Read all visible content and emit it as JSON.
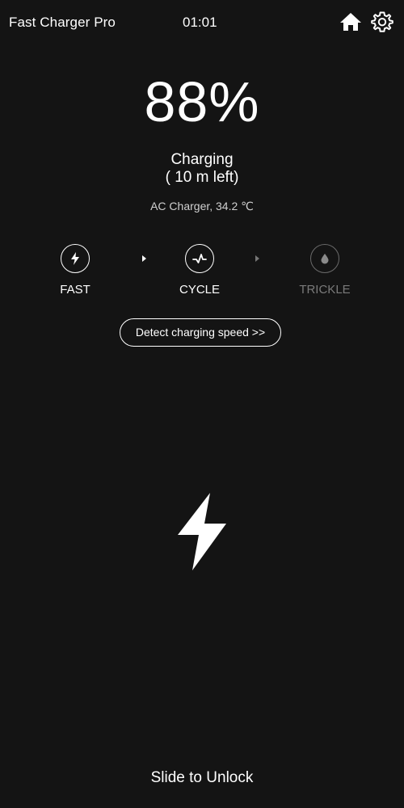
{
  "header": {
    "app_title": "Fast Charger Pro",
    "time": "01:01",
    "home_icon": "home-icon",
    "settings_icon": "gear-icon"
  },
  "battery": {
    "percent": "88%",
    "status": "Charging",
    "time_left": "( 10 m left)",
    "charger_info": "AC Charger, 34.2 ℃"
  },
  "modes": [
    {
      "label": "FAST",
      "icon": "bolt-icon",
      "active": true
    },
    {
      "label": "CYCLE",
      "icon": "pulse-icon",
      "active": true
    },
    {
      "label": "TRICKLE",
      "icon": "drop-icon",
      "active": false
    }
  ],
  "detect_button": {
    "label": "Detect charging speed >>"
  },
  "center_icon": "lightning-bolt-icon",
  "footer": {
    "slide_label": "Slide to Unlock"
  },
  "colors": {
    "background": "#141414",
    "text": "#ffffff",
    "dim": "#7a7a7a"
  }
}
